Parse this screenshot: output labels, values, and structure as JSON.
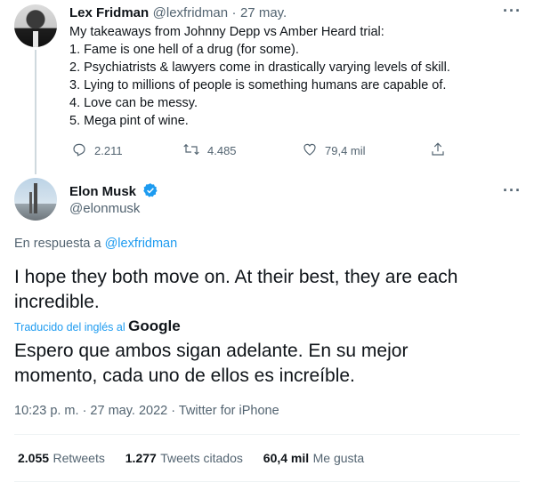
{
  "parent": {
    "name": "Lex Fridman",
    "handle": "@lexfridman",
    "sep": "·",
    "date": "27 may.",
    "lines": [
      "My takeaways from Johnny Depp vs Amber Heard trial:",
      "1. Fame is one hell of a drug (for some).",
      "2. Psychiatrists & lawyers come in drastically varying levels of skill.",
      "3. Lying to millions of people is something humans are capable of.",
      "4. Love can be messy.",
      "5. Mega pint of wine."
    ],
    "replies": "2.211",
    "retweets": "4.485",
    "likes": "79,4 mil"
  },
  "main": {
    "name": "Elon Musk",
    "handle": "@elonmusk",
    "reply_prefix": "En respuesta a",
    "reply_to": "@lexfridman",
    "text_line1": "I hope they both move on. At their best, they are each",
    "text_line2": "incredible.",
    "translated_label": "Traducido del inglés al",
    "google": "Google",
    "translation_line1": "Espero que ambos sigan adelante. En su mejor",
    "translation_line2": "momento, cada uno de ellos es increíble.",
    "timestamp": "10:23 p. m. · 27 may. 2022 · Twitter for iPhone",
    "stats": {
      "retweets_num": "2.055",
      "retweets_lbl": "Retweets",
      "quotes_num": "1.277",
      "quotes_lbl": "Tweets citados",
      "likes_num": "60,4 mil",
      "likes_lbl": "Me gusta"
    }
  },
  "colors": {
    "accent": "#1d9bf0",
    "gray": "#536471",
    "text": "#0f1419"
  },
  "icons": [
    "more-icon",
    "reply-icon",
    "retweet-icon",
    "like-icon",
    "share-icon",
    "verified-icon"
  ]
}
